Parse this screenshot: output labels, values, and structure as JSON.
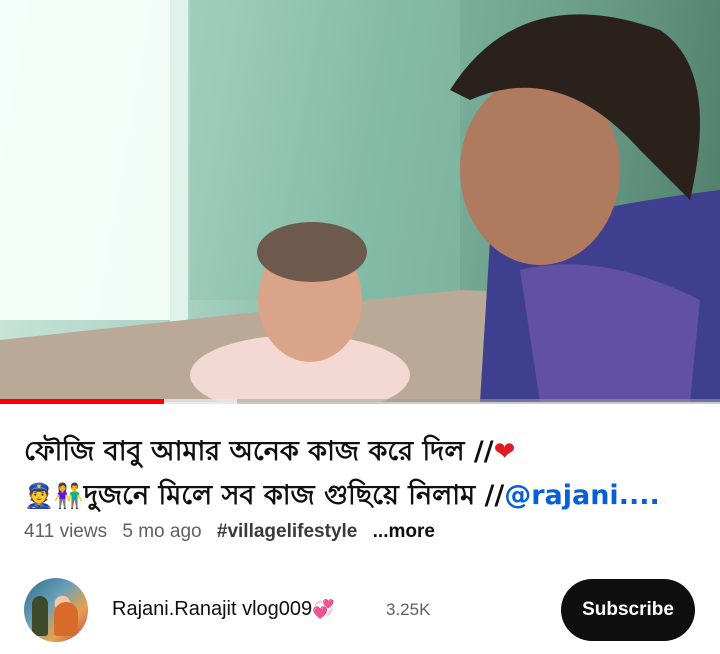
{
  "video": {
    "progress_fraction": 0.228,
    "buffer_fraction": 0.33
  },
  "title": {
    "line1_text": "ফৌজি বাবু আমার অনেক কাজ করে দিল //",
    "line1_heart": "❤",
    "line2_emoji1": "👮",
    "line2_emoji2": "👫",
    "line2_text": "দুজনে মিলে সব কাজ গুছিয়ে নিলাম //",
    "line2_mention": "@rajani...."
  },
  "meta": {
    "views": "411 views",
    "age": "5 mo ago",
    "hashtag": "#villagelifestyle",
    "more": "...more"
  },
  "channel": {
    "name": "Rajani.Ranajit vlog009",
    "name_emoji": "💞",
    "subscribers": "3.25K",
    "subscribe_label": "Subscribe"
  },
  "colors": {
    "progress": "#ff0000",
    "mention": "#065fd4",
    "subscribe_bg": "#0f0f0f"
  }
}
